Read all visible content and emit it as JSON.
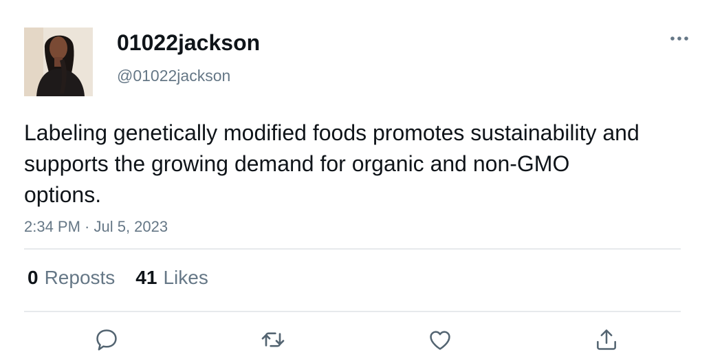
{
  "user": {
    "display_name": "01022jackson",
    "handle": "@01022jackson"
  },
  "tweet": {
    "text": "Labeling genetically modified foods promotes sustainability and supports the growing demand for organic and non-GMO options.",
    "timestamp": "2:34 PM · Jul 5, 2023"
  },
  "stats": {
    "reposts_count": "0",
    "reposts_label": "Reposts",
    "likes_count": "41",
    "likes_label": "Likes"
  },
  "icons": {
    "more": "more-horizontal-icon",
    "reply": "reply-icon",
    "retweet": "retweet-icon",
    "like": "heart-icon",
    "share": "share-icon"
  },
  "colors": {
    "text_primary": "#0f1419",
    "text_secondary": "#657786",
    "divider": "#e6e9ec"
  }
}
